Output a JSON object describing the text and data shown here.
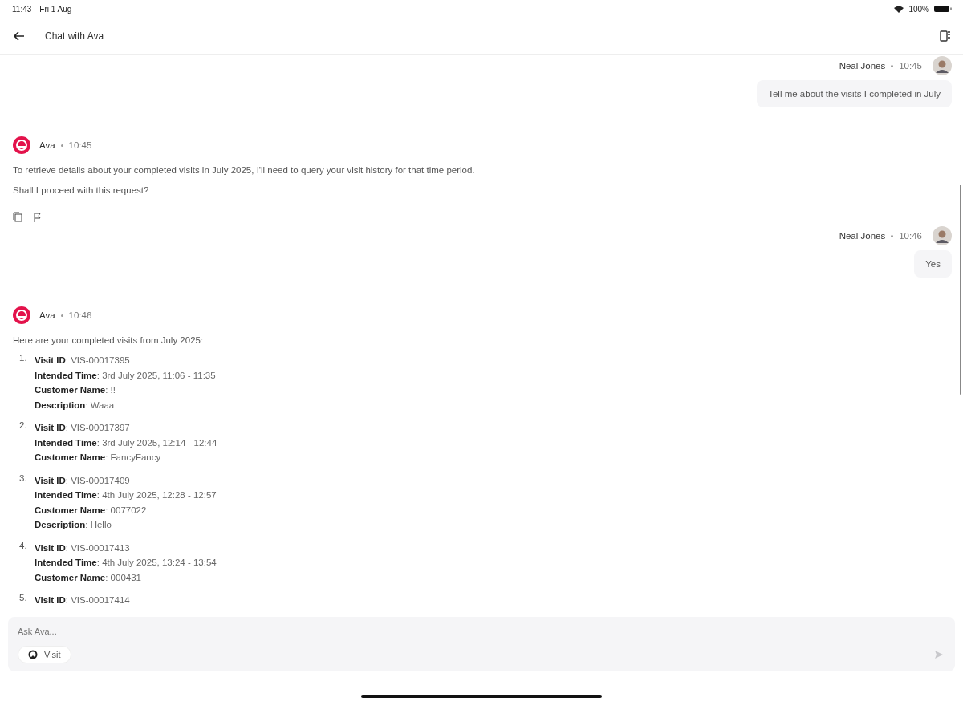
{
  "status_bar": {
    "time": "11:43",
    "date": "Fri 1 Aug",
    "battery": "100%"
  },
  "header": {
    "title": "Chat with Ava"
  },
  "messages": [
    {
      "kind": "user",
      "author": "Neal Jones",
      "time": "10:45",
      "text": "Tell me about the visits I completed in July"
    },
    {
      "kind": "assistant",
      "author": "Ava",
      "time": "10:45",
      "paragraphs": [
        "To retrieve details about your completed visits in July 2025, I'll need to query your visit history for that time period.",
        "Shall I proceed with this request?"
      ],
      "actions": true
    },
    {
      "kind": "user",
      "author": "Neal Jones",
      "time": "10:46",
      "text": "Yes"
    },
    {
      "kind": "assistant",
      "author": "Ava",
      "time": "10:46",
      "paragraphs": [
        "Here are your completed visits from July 2025:"
      ],
      "list": [
        {
          "number": "1.",
          "lines": [
            "**Visit ID**: VIS-00017395",
            "**Intended Time**: 3rd July 2025, 11:06 - 11:35",
            "**Customer Name**: !!",
            "**Description**: Waaa"
          ]
        },
        {
          "number": "2.",
          "lines": [
            "**Visit ID**: VIS-00017397",
            "**Intended Time**: 3rd July 2025, 12:14 - 12:44",
            "**Customer Name**: FancyFancy"
          ]
        },
        {
          "number": "3.",
          "lines": [
            "**Visit ID**: VIS-00017409",
            "**Intended Time**: 4th July 2025, 12:28 - 12:57",
            "**Customer Name**: 0077022",
            "**Description**: Hello"
          ]
        },
        {
          "number": "4.",
          "lines": [
            "**Visit ID**: VIS-00017413",
            "**Intended Time**: 4th July 2025, 13:24 - 13:54",
            "**Customer Name**: 000431"
          ]
        },
        {
          "number": "5.",
          "lines": [
            "**Visit ID**: VIS-00017414"
          ]
        }
      ],
      "actions": false
    }
  ],
  "composer": {
    "placeholder": "Ask Ava...",
    "chip": "Visit"
  }
}
